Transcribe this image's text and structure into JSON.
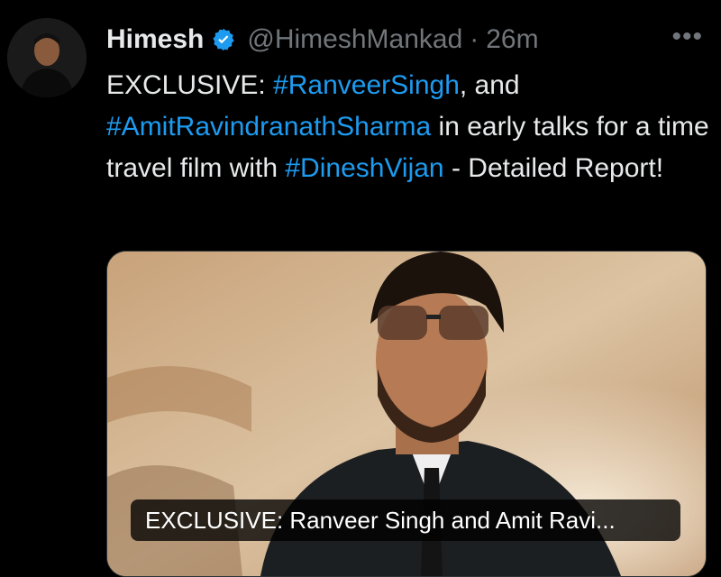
{
  "author": {
    "name": "Himesh",
    "handle": "@HimeshMankad",
    "separator": "·",
    "time": "26m",
    "verified": true
  },
  "more_icon": "•••",
  "tweet": {
    "parts": [
      {
        "type": "text",
        "text": "EXCLUSIVE: "
      },
      {
        "type": "hashtag",
        "text": "#RanveerSingh"
      },
      {
        "type": "text",
        "text": ", and "
      },
      {
        "type": "hashtag",
        "text": "#AmitRavindranathSharma"
      },
      {
        "type": "text",
        "text": " in early talks for a time travel film with "
      },
      {
        "type": "hashtag",
        "text": "#DineshVijan"
      },
      {
        "type": "text",
        "text": " - Detailed Report!"
      }
    ]
  },
  "media": {
    "caption": "EXCLUSIVE: Ranveer Singh and Amit Ravi...",
    "alt": "photo"
  },
  "colors": {
    "background": "#000000",
    "text": "#e7e9ea",
    "muted": "#71767b",
    "link": "#1d9bf0"
  },
  "icons": [
    "avatar",
    "verified-badge-icon",
    "more-options-icon"
  ]
}
